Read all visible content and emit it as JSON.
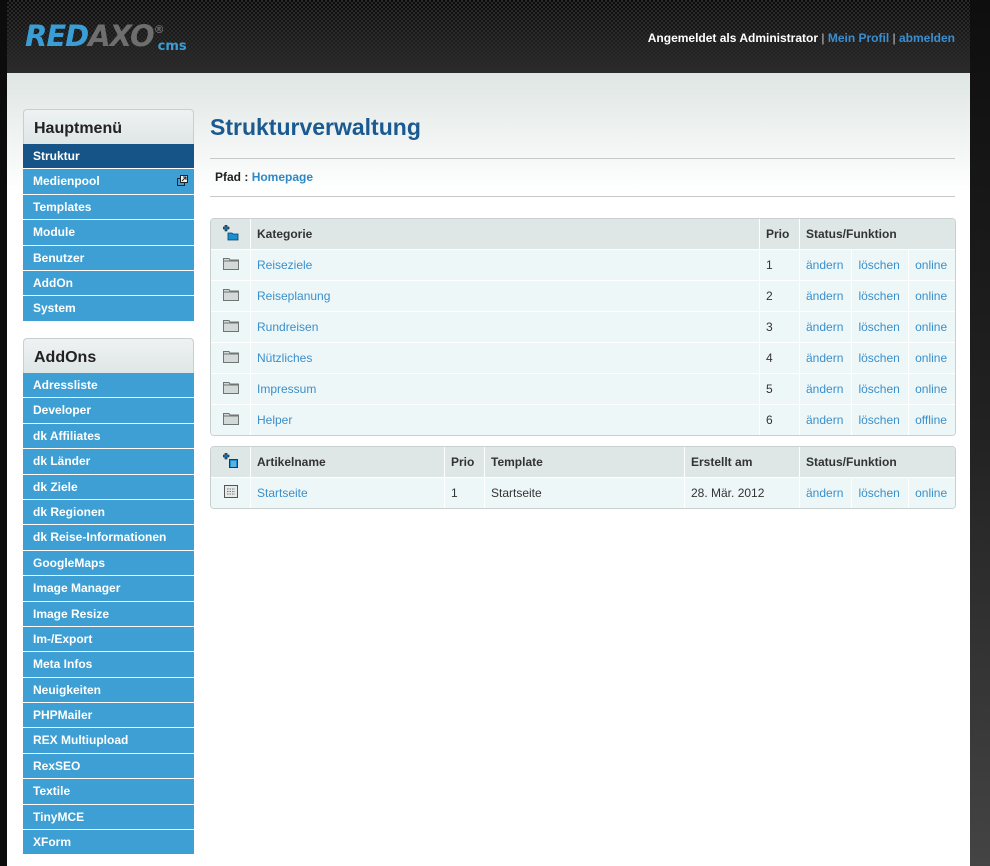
{
  "header": {
    "logo": {
      "part1": "RED",
      "part2": "AXO",
      "registered": "®",
      "suffix": "cms"
    },
    "logged_in_text": "Angemeldet als Administrator",
    "separator": "|",
    "profile_link": "Mein Profil",
    "logout_link": "abmelden"
  },
  "sidebar": {
    "main_menu": {
      "title": "Hauptmenü",
      "items": [
        {
          "label": "Struktur",
          "active": true
        },
        {
          "label": "Medienpool",
          "icon": "popup-window-icon"
        },
        {
          "label": "Templates"
        },
        {
          "label": "Module"
        },
        {
          "label": "Benutzer"
        },
        {
          "label": "AddOn"
        },
        {
          "label": "System"
        }
      ]
    },
    "addons": {
      "title": "AddOns",
      "items": [
        {
          "label": "Adressliste"
        },
        {
          "label": "Developer"
        },
        {
          "label": "dk Affiliates"
        },
        {
          "label": "dk Länder"
        },
        {
          "label": "dk Ziele"
        },
        {
          "label": "dk Regionen"
        },
        {
          "label": "dk Reise-Informationen"
        },
        {
          "label": "GoogleMaps"
        },
        {
          "label": "Image Manager"
        },
        {
          "label": "Image Resize"
        },
        {
          "label": "Im-/Export"
        },
        {
          "label": "Meta Infos"
        },
        {
          "label": "Neuigkeiten"
        },
        {
          "label": "PHPMailer"
        },
        {
          "label": "REX Multiupload"
        },
        {
          "label": "RexSEO"
        },
        {
          "label": "Textile"
        },
        {
          "label": "TinyMCE"
        },
        {
          "label": "XForm"
        }
      ]
    }
  },
  "main": {
    "title": "Strukturverwaltung",
    "path_label": "Pfad :",
    "path_link": "Homepage",
    "categories": {
      "headers": {
        "icon": "add-category-icon",
        "name": "Kategorie",
        "prio": "Prio",
        "status": "Status/Funktion"
      },
      "rows": [
        {
          "name": "Reiseziele",
          "prio": "1",
          "edit": "ändern",
          "delete": "löschen",
          "status": "online"
        },
        {
          "name": "Reiseplanung",
          "prio": "2",
          "edit": "ändern",
          "delete": "löschen",
          "status": "online"
        },
        {
          "name": "Rundreisen",
          "prio": "3",
          "edit": "ändern",
          "delete": "löschen",
          "status": "online"
        },
        {
          "name": "Nützliches",
          "prio": "4",
          "edit": "ändern",
          "delete": "löschen",
          "status": "online"
        },
        {
          "name": "Impressum",
          "prio": "5",
          "edit": "ändern",
          "delete": "löschen",
          "status": "online"
        },
        {
          "name": "Helper",
          "prio": "6",
          "edit": "ändern",
          "delete": "löschen",
          "status": "offline"
        }
      ]
    },
    "articles": {
      "headers": {
        "icon": "add-article-icon",
        "name": "Artikelname",
        "prio": "Prio",
        "template": "Template",
        "created": "Erstellt am",
        "status": "Status/Funktion"
      },
      "rows": [
        {
          "name": "Startseite",
          "prio": "1",
          "template": "Startseite",
          "created": "28. Mär. 2012",
          "edit": "ändern",
          "delete": "löschen",
          "status": "online"
        }
      ]
    }
  },
  "colors": {
    "nav_bg": "#3d9fd3",
    "nav_active": "#165488",
    "link": "#3a8fcc",
    "online": "#3dba3d",
    "offline": "#a00d0d",
    "title": "#1a5a90"
  }
}
